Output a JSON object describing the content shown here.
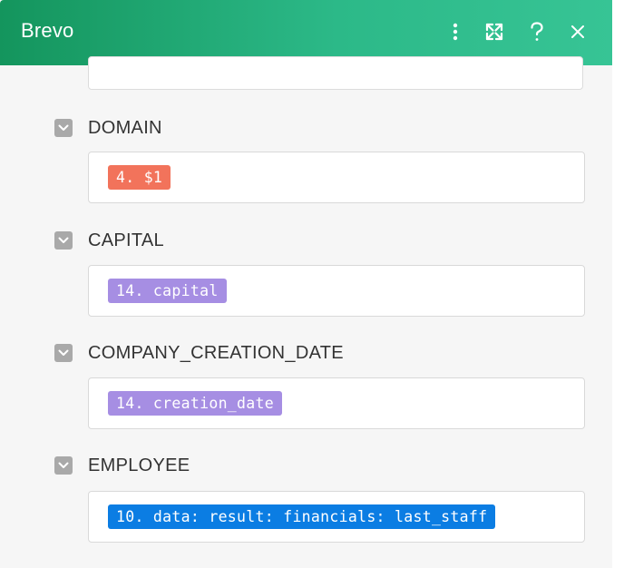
{
  "dialog": {
    "title": "Brevo",
    "header_buttons": {
      "more": "more-vertical-icon",
      "expand": "expand-icon",
      "help": "help-icon",
      "close": "close-icon"
    },
    "header_color": "#1fa874"
  },
  "fields": [
    {
      "label": "DOMAIN",
      "pill_text": "4. $1",
      "pill_color": "#f2735b"
    },
    {
      "label": "CAPITAL",
      "pill_text": "14. capital",
      "pill_color": "#a68ee3"
    },
    {
      "label": "COMPANY_CREATION_DATE",
      "pill_text": "14. creation_date",
      "pill_color": "#a68ee3"
    },
    {
      "label": "EMPLOYEE",
      "pill_text": "10. data: result: financials: last_staff",
      "pill_color": "#0b7de3"
    }
  ]
}
